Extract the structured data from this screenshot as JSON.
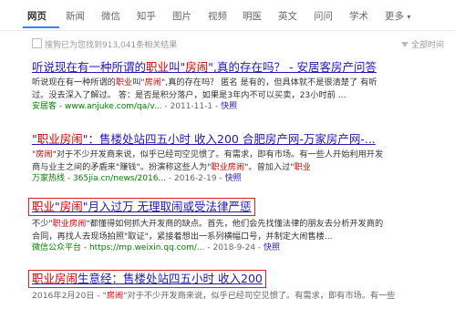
{
  "nav": {
    "items": [
      "网页",
      "新闻",
      "微信",
      "知乎",
      "图片",
      "视频",
      "明医",
      "英文",
      "问问",
      "学术",
      "更多"
    ],
    "active_index": 0,
    "more_arrow": "▾"
  },
  "result_count": "搜狗已为您找到913,041条相关结果",
  "tools_label": "全部时间",
  "results": [
    {
      "title_a": "听说现在有一种所谓的",
      "title_em1": "职业",
      "title_b": "叫\"",
      "title_em2": "房闹",
      "title_c": "\",真的存在吗？ - 安居客房产问答",
      "snippet1_a": "听说现在有一种所谓的",
      "snippet1_em1": "职业",
      "snippet1_b": "叫\"",
      "snippet1_em2": "房闹",
      "snippet1_c": "\",真的存在吗？  匿名 是有的，但具体就不是很清楚了 有听",
      "snippet2": "过。没去深入了解过。  答：是否是积分落户，如果是3年内不可以买卖，23小时前 ...",
      "url": "安居客 - www.anjuke.com/qa/v...",
      "date": "- 2011-11-1 -",
      "snapshot": "快照"
    },
    {
      "title_pre": "\"",
      "title_em1": "职业房闹",
      "title_b": "\"：售楼处站四五小时 收入200  合肥房产网-万家房产网-...",
      "snippet1_a": "\"",
      "snippet1_em1": "房闹",
      "snippet1_b": "\"对于不少开发商来说，似乎已经司空见惯了。有需求，即有市场。有一些人开始利用开发",
      "snippet2_a": "商与业主之间的矛盾来\"赚钱\"。扮演称这些人为\"",
      "snippet2_em1": "职业房闹",
      "snippet2_b": "\"。曾加入过\"",
      "snippet2_em2": "职业",
      "url": "万家热线 - 365jia.cn/news/2016...",
      "date": "- 2016-2-19 -",
      "snapshot": "快照"
    },
    {
      "title_em1": "职业",
      "title_b": "\"",
      "title_em2": "房闹",
      "title_c": "\"月入过万 无理取闹或受法律严惩",
      "snippet1_a": "不少\"",
      "snippet1_em1": "职业房闹",
      "snippet1_b": "\"都懂得如何抓大开发商的缺点。首先，他们会先找懂法律的朋友去分析开发商的",
      "snippet2": "合同，再找人去现场拍照\"取证\"，紧接着想出一系列横幅口号，并制定大闹售楼...",
      "url": "微信公众平台 - https://mp.weixin.qq.com/...",
      "date": "- 2018-9-24 -",
      "snapshot": "快照"
    },
    {
      "title_em1": "职业房闹",
      "title_b": "生意经：售楼处站四五小时 收入200",
      "snippet1_a": "2016年2月20日 - \"",
      "snippet1_em1": "房闹",
      "snippet1_b": "\"对于不少开发商来说，似乎已经司空见惯了。有需求，即有市场。有一些"
    }
  ],
  "colors": {
    "link": "#2518b5",
    "highlight": "#cc0000",
    "url": "#008000",
    "box": "#e02020",
    "nav_accent": "#3385ff"
  }
}
